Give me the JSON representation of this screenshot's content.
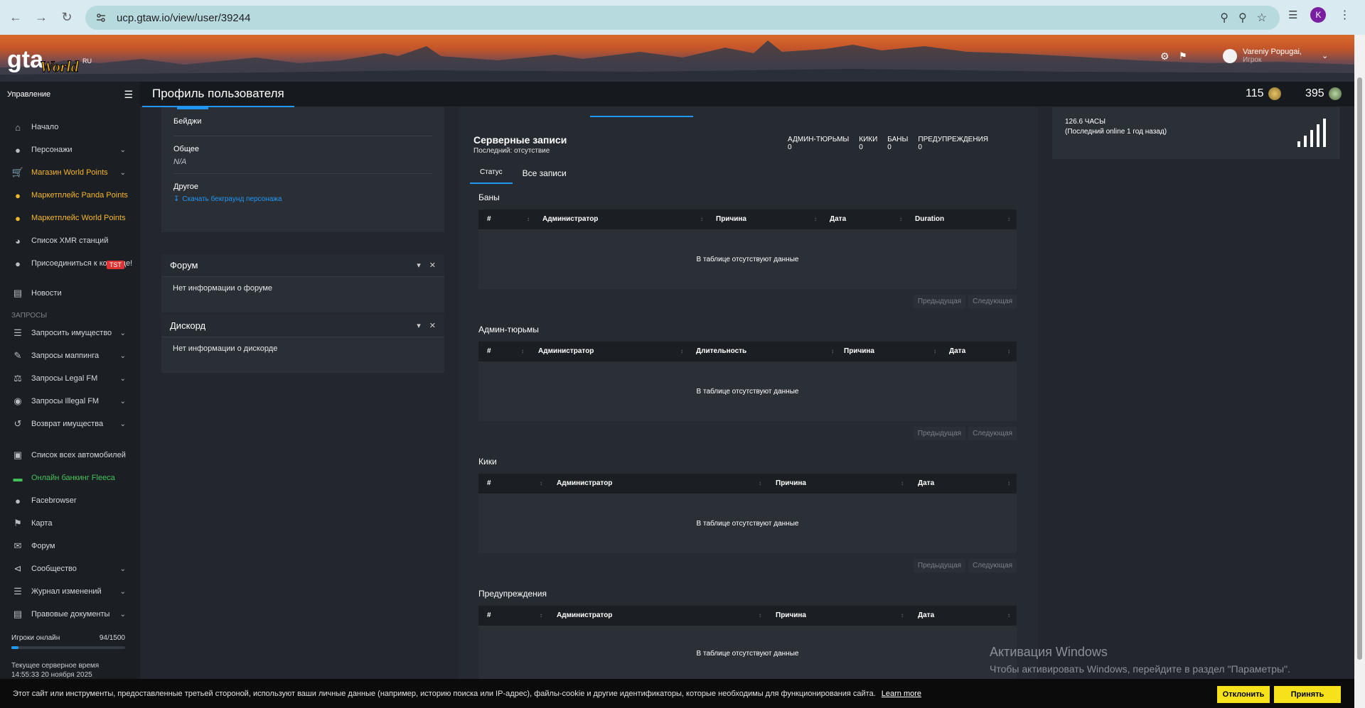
{
  "browser": {
    "url": "ucp.gtaw.io/view/user/39244",
    "profile_initial": "K"
  },
  "banner": {
    "logo_text": "gta World",
    "user_name": "Vareniy Popugai,",
    "user_role": "Игрок"
  },
  "header": {
    "sidebar_title": "Управление",
    "page_title": "Профиль пользователя",
    "points_a": "115",
    "points_b": "395"
  },
  "sidebar": {
    "items": [
      {
        "label": "Начало"
      },
      {
        "label": "Персонажи"
      },
      {
        "label": "Магазин World Points"
      },
      {
        "label": "Маркетплейс Panda Points"
      },
      {
        "label": "Маркетплейс World Points"
      },
      {
        "label": "Список XMR станций"
      },
      {
        "label": "Присоединиться к команде!"
      },
      {
        "label": "Новости"
      },
      {
        "label": "Запросить имущество"
      },
      {
        "label": "Запросы маппинга"
      },
      {
        "label": "Запросы Legal FM"
      },
      {
        "label": "Запросы Illegal FM"
      },
      {
        "label": "Возврат имущества"
      },
      {
        "label": "Список всех автомобилей"
      },
      {
        "label": "Онлайн банкинг Fleeca"
      },
      {
        "label": "Facebrowser"
      },
      {
        "label": "Карта"
      },
      {
        "label": "Форум"
      },
      {
        "label": "Сообщество"
      },
      {
        "label": "Журнал изменений"
      },
      {
        "label": "Правовые документы"
      }
    ],
    "section_requests": "ЗАПРОСЫ",
    "tst_badge": "TST",
    "players_online_label": "Игроки онлайн",
    "players_online_value": "94/1500",
    "players_online_fraction": 0.063,
    "server_time_label": "Текущее серверное время",
    "server_time_value": "14:55:33 20 ноября 2025"
  },
  "left_panel": {
    "badges_label": "Бейджи",
    "general_label": "Общее",
    "general_value": "N/A",
    "other_label": "Другое",
    "download_link": "Скачать бекграунд персонажа",
    "forum_title": "Форум",
    "forum_body": "Нет информации о форуме",
    "discord_title": "Дискорд",
    "discord_body": "Нет информации о дискорде"
  },
  "records": {
    "title": "Серверные записи",
    "subtitle": "Последний: отсутствие",
    "stats": [
      {
        "label": "АДМИН-ТЮРЬМЫ",
        "value": "0"
      },
      {
        "label": "КИКИ",
        "value": "0"
      },
      {
        "label": "БАНЫ",
        "value": "0"
      },
      {
        "label": "ПРЕДУПРЕЖДЕНИЯ",
        "value": "0"
      }
    ],
    "tab_status": "Статус",
    "tab_all": "Все записи",
    "empty_text": "В таблице отсутствуют данные",
    "prev": "Предыдущая",
    "next": "Следующая",
    "bans": {
      "name": "Баны",
      "cols": [
        "#",
        "Администратор",
        "Причина",
        "Дата",
        "Duration"
      ]
    },
    "jails": {
      "name": "Админ-тюрьмы",
      "cols": [
        "#",
        "Администратор",
        "Длительность",
        "Причина",
        "Дата"
      ]
    },
    "kicks": {
      "name": "Кики",
      "cols": [
        "#",
        "Администратор",
        "Причина",
        "Дата"
      ]
    },
    "warns": {
      "name": "Предупреждения",
      "cols": [
        "#",
        "Администратор",
        "Причина",
        "Дата"
      ]
    }
  },
  "hours_card": {
    "hours": "126.6 ЧАСЫ",
    "last_online": "(Последний online 1 год назад)"
  },
  "watermark": {
    "title": "Активация Windows",
    "text": "Чтобы активировать Windows, перейдите в раздел \"Параметры\"."
  },
  "cookie": {
    "text": "Этот сайт или инструменты, предоставленные третьей стороной, используют ваши личные данные (например, историю поиска или IP-адрес), файлы-cookie и другие идентификаторы, которые необходимы для функционирования сайта.",
    "learn_more": "Learn more",
    "decline": "Отклонить",
    "accept": "Принять"
  }
}
